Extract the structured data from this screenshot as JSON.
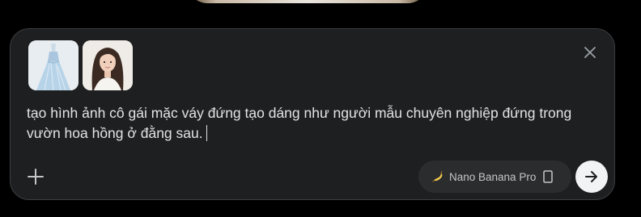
{
  "composer": {
    "prompt_text": "tạo hình ảnh cô gái mặc váy đứng tạo dáng như người mẫu chuyên nghiệp đứng trong vườn hoa hồng ở đằng sau.",
    "attachments": [
      {
        "kind": "image",
        "subject": "light blue gown"
      },
      {
        "kind": "image",
        "subject": "portrait of a woman"
      }
    ],
    "model_label": "Nano Banana Pro",
    "icons": {
      "close": "close-icon",
      "add": "plus-icon",
      "model": "banana-icon",
      "device": "phone-icon",
      "send": "arrow-right-icon"
    }
  },
  "colors": {
    "page_background": "#000000",
    "composer_background": "#1e1f20",
    "pill_background": "#2b2c2e",
    "text": "#e3e3e3",
    "send_button": "#f1f3f4"
  }
}
